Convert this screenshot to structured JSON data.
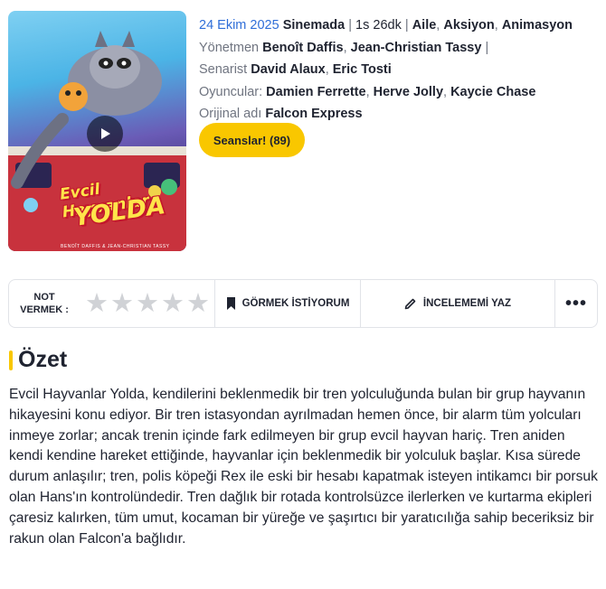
{
  "poster": {
    "title_line1": "Evcil Hayvanlar",
    "title_line2": "YOLDA",
    "credit": "BENOÎT DAFFIS & JEAN-CHRISTIAN TASSY",
    "play_icon": "play-icon"
  },
  "info": {
    "release_date": "24 Ekim 2025",
    "release_venue": "Sinemada",
    "duration": "1s 26dk",
    "genres": [
      "Aile",
      "Aksiyon",
      "Animasyon"
    ],
    "director_label": "Yönetmen",
    "directors": [
      "Benoît Daffis",
      "Jean-Christian Tassy"
    ],
    "writer_label": "Senarist",
    "writers": [
      "David Alaux",
      "Eric Tosti"
    ],
    "cast_label": "Oyuncular:",
    "cast": [
      "Damien Ferrette",
      "Herve Jolly",
      "Kaycie Chase"
    ],
    "original_title_label": "Orijinal adı",
    "original_title": "Falcon Express",
    "sessions_button": "Seanslar! (89)"
  },
  "actions": {
    "rate_label_line1": "NOT",
    "rate_label_line2": "VERMEK :",
    "star_count": 5,
    "rating": 0,
    "watchlist_label": "GÖRMEK İSTİYORUM",
    "review_label": "İNCELEMEMİ YAZ",
    "more_label": "•••",
    "icons": [
      "bookmark-icon",
      "pencil-icon",
      "more-icon"
    ]
  },
  "summary": {
    "title": "Özet",
    "text": "Evcil Hayvanlar Yolda, kendilerini beklenmedik bir tren yolculuğunda bulan bir grup hayvanın hikayesini konu ediyor. Bir tren istasyondan ayrılmadan hemen önce, bir alarm tüm yolcuları inmeye zorlar; ancak trenin içinde fark edilmeyen bir grup evcil hayvan hariç. Tren aniden kendi kendine hareket ettiğinde, hayvanlar için beklenmedik bir yolculuk başlar. Kısa sürede durum anlaşılır; tren, polis köpeği Rex ile eski bir hesabı kapatmak isteyen intikamcı bir porsuk olan Hans'ın kontrolündedir. Tren dağlık bir rotada kontrolsüzce ilerlerken ve kurtarma ekipleri çaresiz kalırken, tüm umut, kocaman bir yüreğe ve şaşırtıcı bir yaratıcılığa sahip beceriksiz bir rakun olan Falcon'a bağlıdır."
  },
  "colors": {
    "accent": "#f9c700",
    "date_link": "#2f6ed8",
    "muted": "#6f7480",
    "star_empty": "#d0d2d6"
  }
}
